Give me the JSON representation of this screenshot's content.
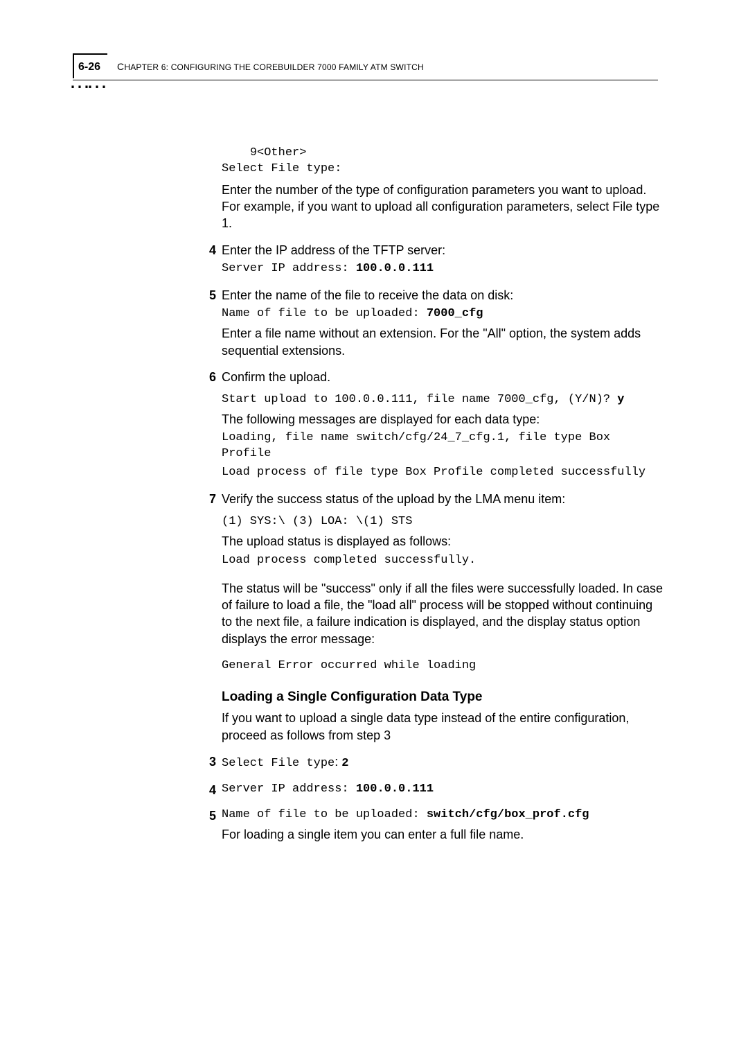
{
  "header": {
    "page_number": "6-26",
    "chapter_label_prefix": "C",
    "chapter_label_tail": "hapter 6: Configuring the CoreBuilder 7000 Family ATM Switch"
  },
  "intro": {
    "mono_line": "    9<Other>\nSelect File type:",
    "para": "Enter the number of the type of configuration parameters you want to upload. For example, if you want to upload all configuration parameters, select File type 1."
  },
  "steps_a": [
    {
      "num": "4",
      "text": "Enter the IP address of the TFTP server:",
      "mono": "Server IP address: ",
      "mono_bold": "100.0.0.111"
    },
    {
      "num": "5",
      "text": "Enter the name of the file to receive the data on disk:",
      "mono": "Name of file to be uploaded: ",
      "mono_bold": "7000_cfg",
      "after": "Enter a file name without an extension. For the \"All\" option, the system adds sequential extensions."
    },
    {
      "num": "6",
      "text": "Confirm the upload.",
      "mono1_pre": "Start upload to 100.0.0.111, file name 7000_cfg, (Y/N)? ",
      "mono1_bold": "y",
      "mid": "The following messages are displayed for each data type:",
      "mono2": "Loading, file name switch/cfg/24_7_cfg.1, file type Box Profile",
      "mono3": "Load process of file type Box Profile completed successfully"
    },
    {
      "num": "7",
      "text": "Verify the success status of the upload by the LMA menu item:",
      "mono1": "(1) SYS:\\ (3) LOA: \\(1) STS",
      "mid": "The upload status is displayed as follows:",
      "mono2": "Load process completed successfully.",
      "after": "The status will be \"success\" only if all the files were successfully loaded. In case of failure to load a file, the \"load all\" process will be stopped without continuing to the next file, a failure indication is displayed, and the display status option displays the error message:",
      "mono3": "General Error occurred while loading"
    }
  ],
  "subheading": "Loading a Single Configuration Data Type",
  "sub_para": "If you want to upload a single data type instead of the entire configuration, proceed as follows from step 3",
  "steps_b": [
    {
      "num": "3",
      "mono_pre": "Select File type",
      "mono_mid": ": ",
      "mono_bold": "2"
    },
    {
      "num": "4",
      "mono_pre": "Server IP address: ",
      "mono_bold": "100.0.0.111"
    },
    {
      "num": "5",
      "mono_pre": "Name of file to be uploaded: ",
      "mono_bold": "switch/cfg/box_prof.cfg",
      "after": "For loading a single item you can enter a full file name."
    }
  ]
}
